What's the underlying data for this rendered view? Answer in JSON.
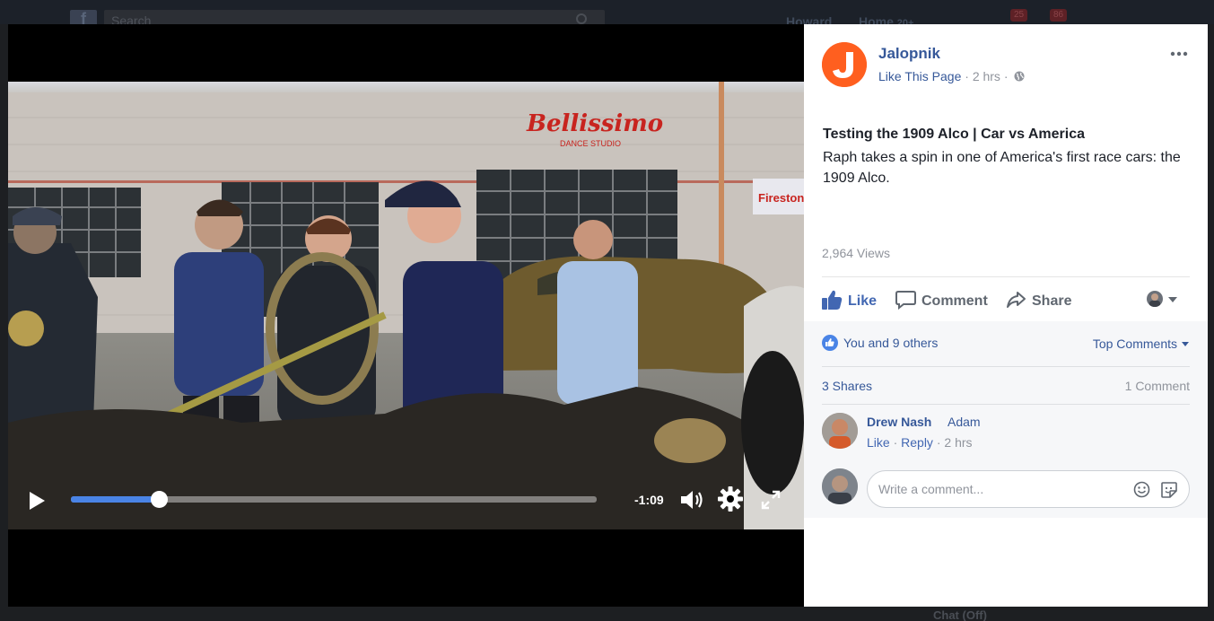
{
  "background_bar": {
    "logo": "f",
    "search_placeholder": "Search",
    "user_name": "Howard",
    "home_label": "Home",
    "home_count": "20+",
    "badge_a": "25",
    "badge_b": "86",
    "chat_label": "Chat (Off)"
  },
  "video": {
    "time_remaining": "-1:09",
    "progress_fraction": 0.168,
    "sign_text": "Bellissimo",
    "sign_subtext": "DANCE STUDIO",
    "side_sign": "Firestone"
  },
  "post": {
    "page_name": "Jalopnik",
    "like_page_label": "Like This Page",
    "time": "2 hrs",
    "title": "Testing the 1909 Alco | Car vs America",
    "description": "Raph takes a spin in one of America's first race cars: the 1909 Alco.",
    "views": "2,964 Views",
    "actions": {
      "like": "Like",
      "comment": "Comment",
      "share": "Share"
    },
    "reactions_text": "You and 9 others",
    "sort_label": "Top Comments",
    "shares_text": "3 Shares",
    "comments_count_text": "1 Comment",
    "comment": {
      "author": "Drew Nash",
      "text": "Adam",
      "like_label": "Like",
      "reply_label": "Reply",
      "time": "2 hrs"
    },
    "write_placeholder": "Write a comment..."
  },
  "colors": {
    "brand_blue": "#365899",
    "jalopnik_orange": "#ff5f1f",
    "progress_blue": "#4a84e6"
  }
}
